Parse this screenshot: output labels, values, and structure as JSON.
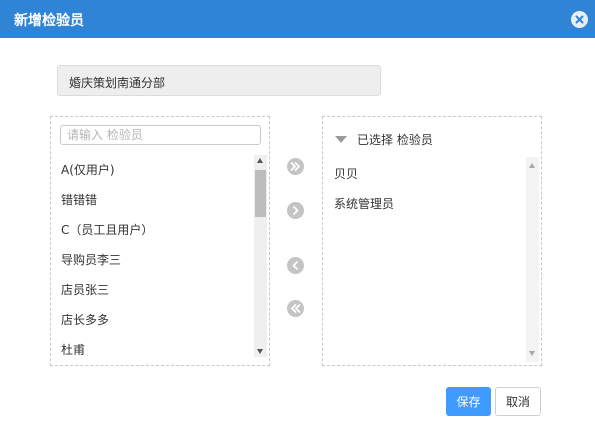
{
  "dialog": {
    "title": "新增检验员",
    "close_icon": "close-icon"
  },
  "department": "婚庆策划南通分部",
  "left_panel": {
    "search_placeholder": "请输入 检验员",
    "items": [
      "A(仅用户)",
      "错错错",
      "C（员工且用户）",
      "导购员李三",
      "店员张三",
      "店长多多",
      "杜甫"
    ]
  },
  "transfer_buttons": {
    "move_all_right": "double-chevron-right-icon",
    "move_right": "chevron-right-icon",
    "move_left": "chevron-left-icon",
    "move_all_left": "double-chevron-left-icon"
  },
  "right_panel": {
    "header": "已选择 检验员",
    "items": [
      "贝贝",
      "系统管理员"
    ]
  },
  "footer": {
    "save_label": "保存",
    "cancel_label": "取消"
  },
  "colors": {
    "titlebar": "#2f84d6",
    "save_button": "#3f9bff",
    "transfer_button": "#c4c4c4"
  }
}
